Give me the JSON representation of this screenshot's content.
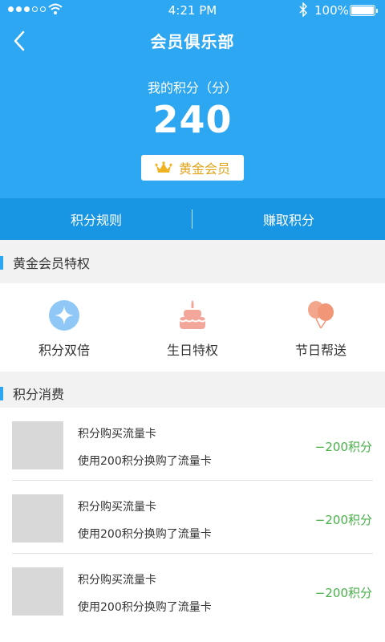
{
  "status_bar": {
    "time": "4:21 PM",
    "battery": "100%"
  },
  "header": {
    "title": "会员俱乐部",
    "points_label": "我的积分（分）",
    "points_value": "240",
    "member_level": "黄金会员"
  },
  "tabs": [
    {
      "label": "积分规则"
    },
    {
      "label": "赚取积分"
    }
  ],
  "privileges": {
    "section_title": "黄金会员特权",
    "items": [
      {
        "label": "积分双倍",
        "icon": "double-points-icon"
      },
      {
        "label": "生日特权",
        "icon": "birthday-cake-icon"
      },
      {
        "label": "节日帮送",
        "icon": "balloons-icon"
      }
    ]
  },
  "consumption": {
    "section_title": "积分消费",
    "records": [
      {
        "title": "积分购买流量卡",
        "description": "使用200积分换购了流量卡",
        "amount": "−200积分"
      },
      {
        "title": "积分购买流量卡",
        "description": "使用200积分换购了流量卡",
        "amount": "−200积分"
      },
      {
        "title": "积分购买流量卡",
        "description": "使用200积分换购了流量卡",
        "amount": "−200积分"
      }
    ]
  },
  "colors": {
    "header_blue": "#2ea7f2",
    "tabbar_blue": "#1895e3",
    "gold": "#e0a51b",
    "amount_green": "#48b048"
  }
}
